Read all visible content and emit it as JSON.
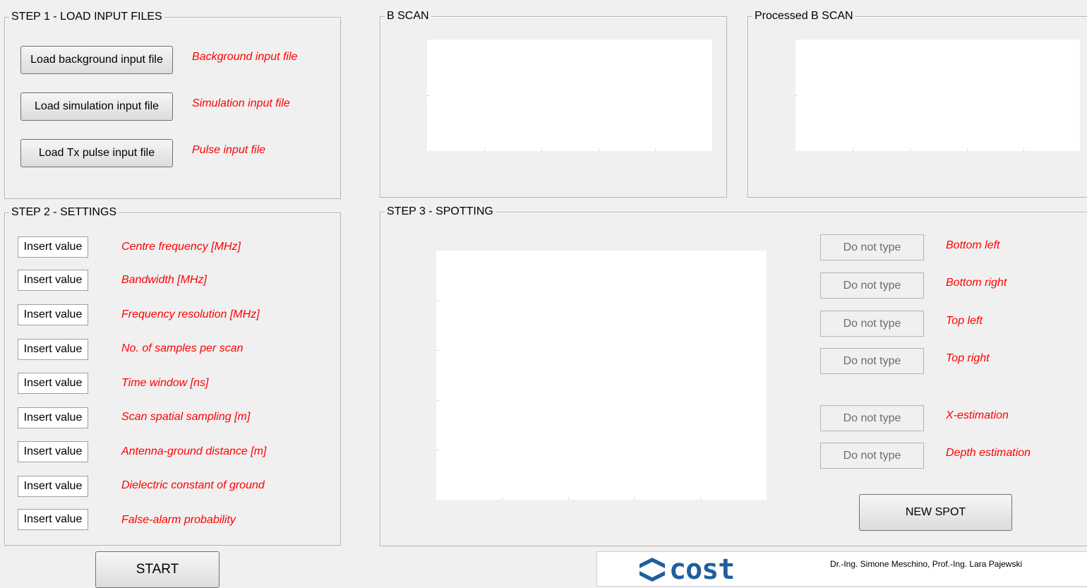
{
  "step1": {
    "title": "STEP 1 - LOAD INPUT FILES",
    "buttons": [
      {
        "label": "Load background input file",
        "status": "Background input file"
      },
      {
        "label": "Load simulation input file",
        "status": "Simulation input file"
      },
      {
        "label": "Load Tx pulse input file",
        "status": "Pulse input file"
      }
    ]
  },
  "bscan": {
    "title": "B SCAN"
  },
  "processed_bscan": {
    "title": "Processed B SCAN"
  },
  "step2": {
    "title": "STEP 2 - SETTINGS",
    "fields": [
      {
        "value": "Insert value",
        "label": "Centre frequency [MHz]"
      },
      {
        "value": "Insert value",
        "label": "Bandwidth [MHz]"
      },
      {
        "value": "Insert value",
        "label": "Frequency resolution [MHz]"
      },
      {
        "value": "Insert value",
        "label": "No. of samples per scan"
      },
      {
        "value": "Insert value",
        "label": "Time window [ns]"
      },
      {
        "value": "Insert value",
        "label": "Scan spatial sampling [m]"
      },
      {
        "value": "Insert value",
        "label": "Antenna-ground distance [m]"
      },
      {
        "value": "Insert value",
        "label": "Dielectric constant of ground"
      },
      {
        "value": "Insert value",
        "label": "False-alarm probability"
      }
    ]
  },
  "step3": {
    "title": "STEP 3 - SPOTTING",
    "outputs": [
      {
        "value": "Do not type",
        "label": "Bottom left"
      },
      {
        "value": "Do not type",
        "label": "Bottom right"
      },
      {
        "value": "Do not type",
        "label": "Top left"
      },
      {
        "value": "Do not type",
        "label": "Top right"
      },
      {
        "value": "Do not type",
        "label": "X-estimation"
      },
      {
        "value": "Do not type",
        "label": "Depth estimation"
      }
    ],
    "new_spot_label": "NEW SPOT"
  },
  "start_label": "START",
  "footer": {
    "logo_text": "cost",
    "credits": "Dr.-Ing. Simone Meschino, Prof.-Ing. Lara Pajewski"
  },
  "colors": {
    "label_red": "#ff0000",
    "background": "#f0f0f0",
    "logo_blue": "#1f5f9c"
  }
}
